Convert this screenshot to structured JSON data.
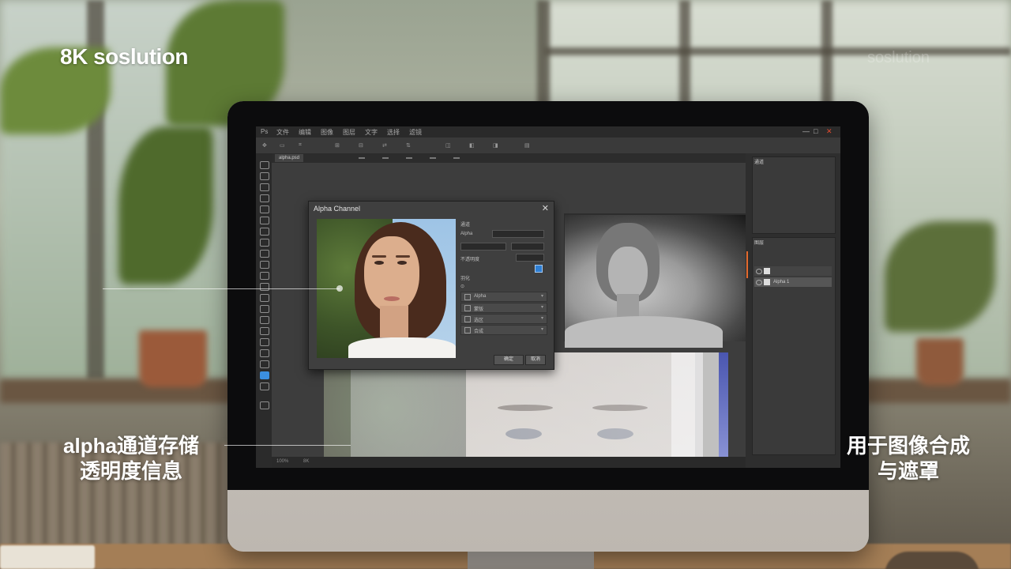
{
  "overlay": {
    "brand": "8K soslution",
    "ghost_text": "soslution",
    "caption_left": [
      "alpha通道存储",
      "透明度信息"
    ],
    "caption_right": [
      "用于图像合成",
      "与遮罩"
    ]
  },
  "app": {
    "menu": [
      "文件",
      "编辑",
      "图像",
      "图层",
      "文字",
      "选择",
      "滤镜"
    ],
    "window_controls": [
      "—",
      "□",
      "✕"
    ],
    "tab_label": "alpha.psd",
    "status": [
      "100%",
      "8K"
    ]
  },
  "dialog": {
    "title": "Alpha Channel",
    "close": "✕",
    "labels": [
      "通道",
      "Alpha",
      "不透明度",
      "羽化"
    ],
    "rows": [
      "Alpha",
      "蒙版",
      "选区",
      "合成"
    ],
    "ok_label": "确定",
    "cancel_label": "取消"
  },
  "panels": {
    "top_tab": "通道",
    "layers_tab": "图层",
    "layer_name": "Alpha 1"
  },
  "colors": {
    "accent_blue": "#3b8fe0",
    "close_red": "#e34b2f",
    "panel_orange": "#e46a2e"
  }
}
